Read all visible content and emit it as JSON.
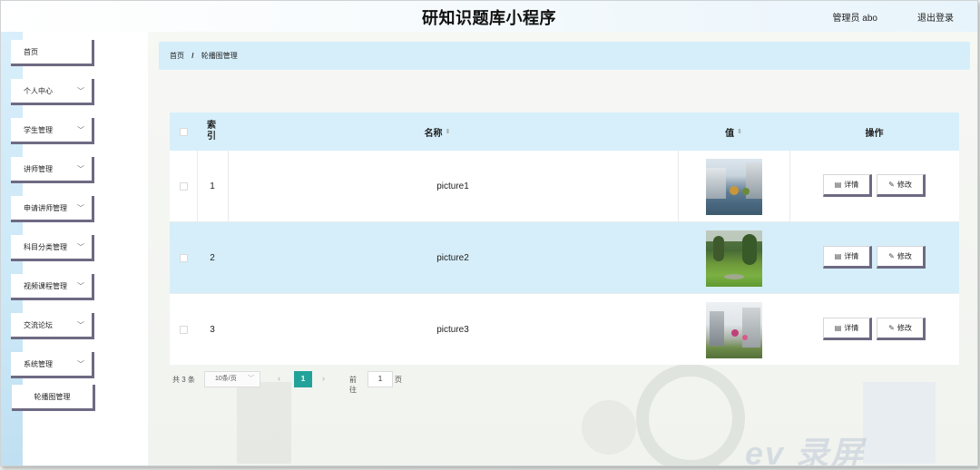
{
  "header": {
    "title": "研知识题库小程序",
    "user": "管理员 abo",
    "logout": "退出登录"
  },
  "sidebar": {
    "items": [
      {
        "label": "首页",
        "has_chevron": false
      },
      {
        "label": "个人中心",
        "has_chevron": true
      },
      {
        "label": "学生管理",
        "has_chevron": true
      },
      {
        "label": "讲师管理",
        "has_chevron": true
      },
      {
        "label": "申请讲师管理",
        "has_chevron": true
      },
      {
        "label": "科目分类管理",
        "has_chevron": true
      },
      {
        "label": "视频课程管理",
        "has_chevron": true
      },
      {
        "label": "交流论坛",
        "has_chevron": true
      },
      {
        "label": "系统管理",
        "has_chevron": true
      }
    ],
    "sub_item": "轮播图管理",
    "chevron_icon": "chevron-down-icon"
  },
  "breadcrumb": {
    "home": "首页",
    "separator": "/",
    "current": "轮播图管理"
  },
  "table": {
    "headers": {
      "index": "索引",
      "name": "名称",
      "value": "值",
      "actions": "操作"
    },
    "rows": [
      {
        "index": "1",
        "name": "picture1",
        "image": "campus-courtyard",
        "detail": "详情",
        "edit": "修改"
      },
      {
        "index": "2",
        "name": "picture2",
        "image": "campus-lawn",
        "detail": "详情",
        "edit": "修改"
      },
      {
        "index": "3",
        "name": "picture3",
        "image": "campus-building",
        "detail": "详情",
        "edit": "修改"
      }
    ]
  },
  "pagination": {
    "total": "共 3 条",
    "page_size": "10条/页",
    "current_page": "1",
    "goto_label": "前往",
    "goto_value": "1",
    "page_word": "页"
  },
  "colors": {
    "accent": "#22a39a",
    "header_blue": "#d7effa",
    "button_border": "#6e6a83"
  }
}
